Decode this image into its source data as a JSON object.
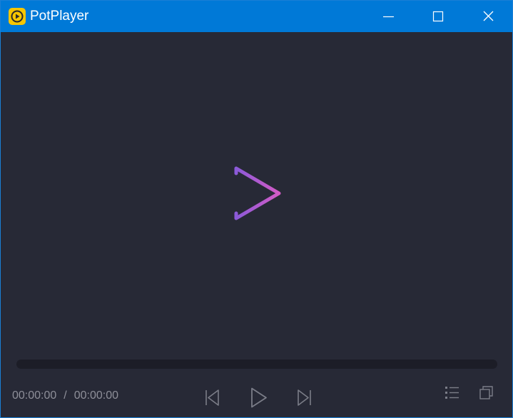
{
  "window": {
    "title": "PotPlayer",
    "title_color": "#ffffff",
    "titlebar_color": "#0079d7",
    "background_color": "#272936"
  },
  "titlebar": {
    "app_icon": "potplayer-logo-icon",
    "buttons": [
      {
        "name": "minimize",
        "icon": "minimize-icon"
      },
      {
        "name": "maximize",
        "icon": "maximize-icon"
      },
      {
        "name": "close",
        "icon": "close-icon"
      }
    ]
  },
  "video_area": {
    "center_logo": "potplayer-play-logo-icon",
    "logo_colors": [
      "#7a57d6",
      "#d05ac8"
    ]
  },
  "seekbar": {
    "progress": 0
  },
  "controls": {
    "current_time": "00:00:00",
    "separator": "/",
    "total_time": "00:00:00",
    "buttons": [
      {
        "name": "previous",
        "icon": "skip-previous-icon"
      },
      {
        "name": "play",
        "icon": "play-icon"
      },
      {
        "name": "next",
        "icon": "skip-next-icon"
      },
      {
        "name": "playlist",
        "icon": "playlist-icon"
      },
      {
        "name": "restore",
        "icon": "restore-window-icon"
      }
    ]
  }
}
